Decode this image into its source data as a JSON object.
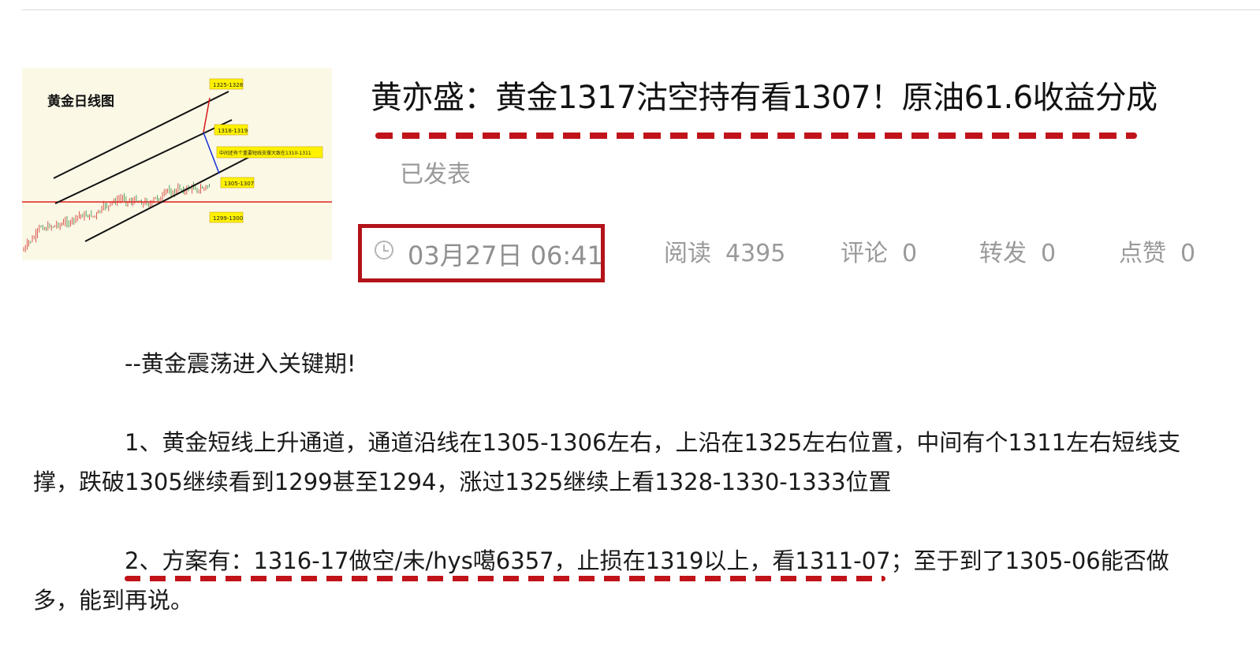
{
  "thumbnail": {
    "chart_title": "黄金日线图",
    "labels": [
      "1325-1328",
      "1318-1319",
      "中间还有个重要短线支撑大致在1310-1311",
      "1305-1307",
      "1299-1300"
    ],
    "colors": {
      "background": "#fbf8e6",
      "channel_line": "#111111",
      "support_line": "#e02020",
      "label_box": "#fff200",
      "arrow_down": "#1530d8",
      "arrow_up": "#d81515",
      "candle_up": "#d0302a",
      "candle_down": "#2f8a3a"
    }
  },
  "article": {
    "title": "黄亦盛：黄金1317沽空持有看1307！原油61.6收益分成",
    "status": "已发表",
    "time": "03月27日 06:41",
    "time_icon": "clock-icon",
    "stats": [
      {
        "label": "阅读",
        "value": "4395"
      },
      {
        "label": "评论",
        "value": "0"
      },
      {
        "label": "转发",
        "value": "0"
      },
      {
        "label": "点赞",
        "value": "0"
      }
    ],
    "paragraphs": [
      "--黄金震荡进入关键期!",
      "1、黄金短线上升通道，通道沿线在1305-1306左右，上沿在1325左右位置，中间有个1311左右短线支撑，跌破1305继续看到1299甚至1294，涨过1325继续上看1328-1330-1333位置",
      "2、方案有：1316-17做空/未/hys噶6357，止损在1319以上，看1311-07；至于到了1305-06能否做多，能到再说。"
    ]
  },
  "colors": {
    "accent_red": "#b3131a",
    "muted_gray": "#9a9a9a"
  }
}
